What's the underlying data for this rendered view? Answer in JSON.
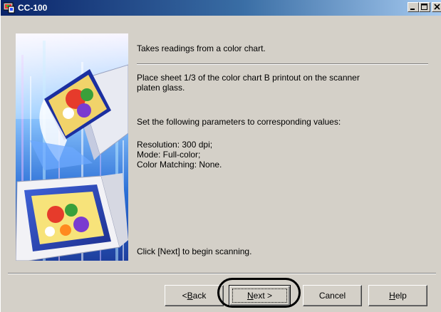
{
  "window": {
    "title": "CC-100"
  },
  "content": {
    "line1": "Takes readings from a color chart.",
    "line2a": "Place sheet 1/3 of the color chart B printout on the scanner",
    "line2b": "platen glass.",
    "line3": "Set the following parameters to corresponding values:",
    "param_resolution": "Resolution: 300 dpi;",
    "param_mode": "Mode: Full-color;",
    "param_color_matching": "Color Matching: None.",
    "instruction": "Click [Next] to begin scanning."
  },
  "buttons": {
    "back_prefix": "< ",
    "back_mnemonic": "B",
    "back_rest": "ack",
    "next_mnemonic": "N",
    "next_rest": "ext >",
    "cancel": "Cancel",
    "help_mnemonic": "H",
    "help_rest": "elp"
  },
  "icons": {
    "app": "scanner-app-icon",
    "minimize": "minimize-icon",
    "maximize": "maximize-icon",
    "close": "close-icon"
  },
  "colors": {
    "titlebar_start": "#0a246a",
    "titlebar_end": "#a6caf0",
    "dialog_face": "#d4d0c8"
  }
}
